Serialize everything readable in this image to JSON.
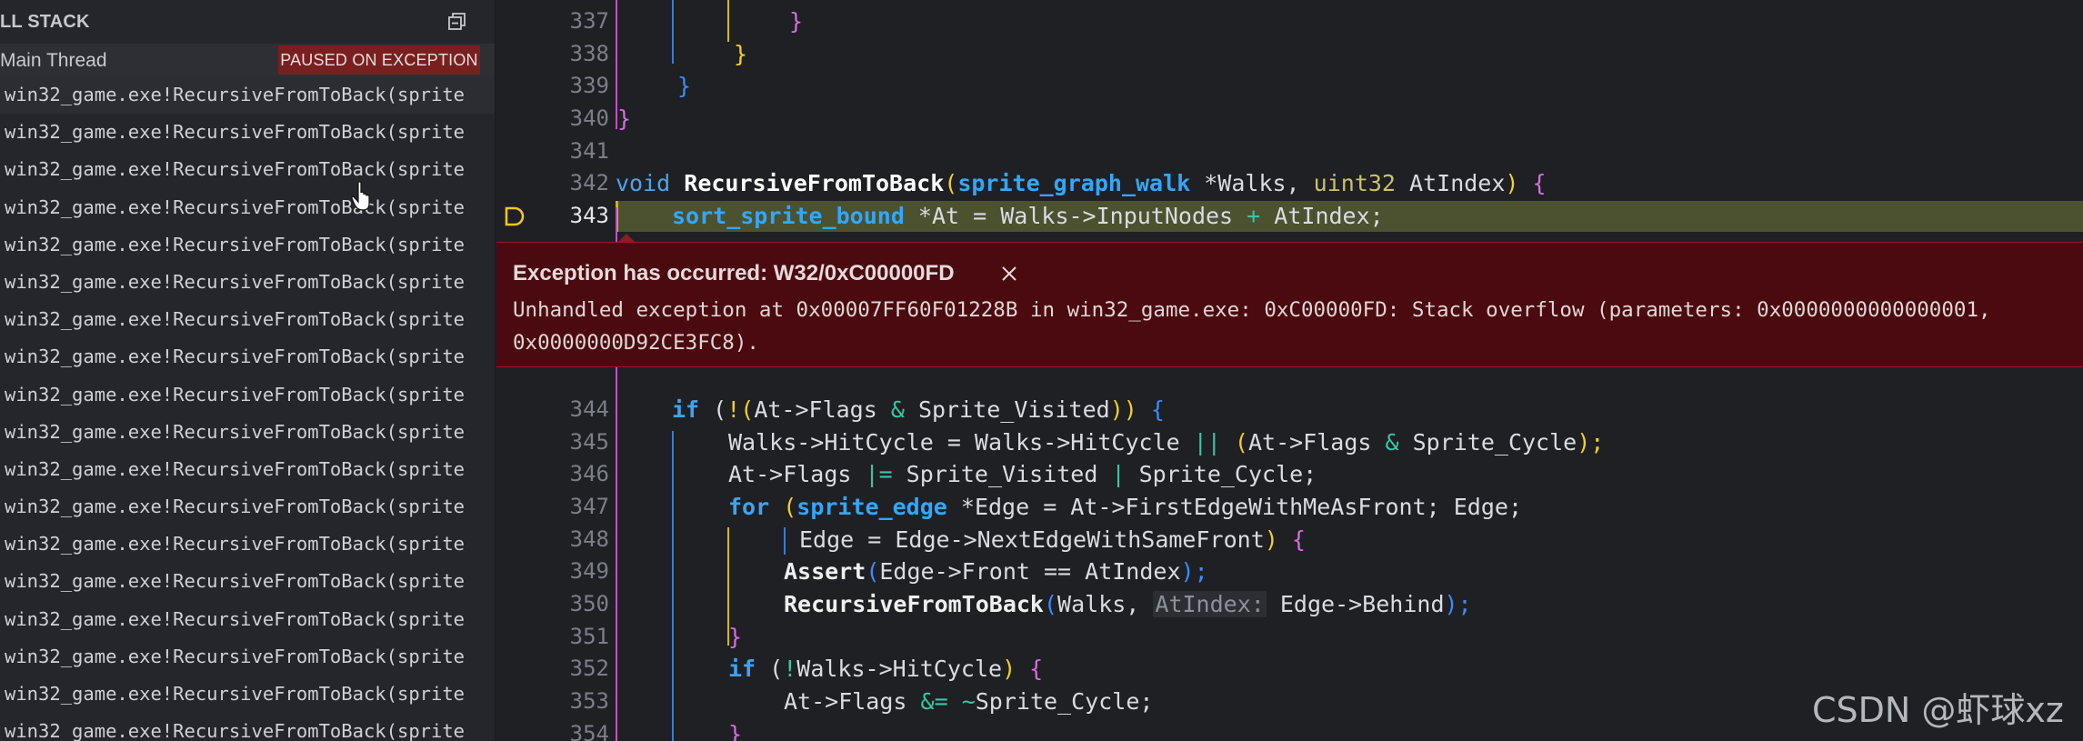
{
  "call_stack": {
    "title": "LL STACK",
    "thread": "Main Thread",
    "badge": "PAUSED ON EXCEPTION",
    "frames": [
      "win32_game.exe!RecursiveFromToBack(sprite",
      "win32_game.exe!RecursiveFromToBack(sprite",
      "win32_game.exe!RecursiveFromToBack(sprite",
      "win32_game.exe!RecursiveFromToBack(sprite",
      "win32_game.exe!RecursiveFromToBack(sprite",
      "win32_game.exe!RecursiveFromToBack(sprite",
      "win32_game.exe!RecursiveFromToBack(sprite",
      "win32_game.exe!RecursiveFromToBack(sprite",
      "win32_game.exe!RecursiveFromToBack(sprite",
      "win32_game.exe!RecursiveFromToBack(sprite",
      "win32_game.exe!RecursiveFromToBack(sprite",
      "win32_game.exe!RecursiveFromToBack(sprite",
      "win32_game.exe!RecursiveFromToBack(sprite",
      "win32_game.exe!RecursiveFromToBack(sprite",
      "win32_game.exe!RecursiveFromToBack(sprite",
      "win32_game.exe!RecursiveFromToBack(sprite",
      "win32_game.exe!RecursiveFromToBack(sprite",
      "win32_game.exe!RecursiveFromToBack(sprite"
    ]
  },
  "editor": {
    "line_numbers": [
      "337",
      "338",
      "339",
      "340",
      "341",
      "342",
      "343",
      "344",
      "345",
      "346",
      "347",
      "348",
      "349",
      "350",
      "351",
      "352",
      "353",
      "354"
    ],
    "current_line": "343",
    "code": {
      "l337": "}",
      "l338": "}",
      "l339": "}",
      "l340": "}",
      "l342_kw": "void",
      "l342_fn": "RecursiveFromToBack",
      "l342_open": "(",
      "l342_t1": "sprite_graph_walk",
      "l342_p1": " *Walks, ",
      "l342_t2": "uint32",
      "l342_p2": " AtIndex",
      "l342_close": ")",
      "l342_brace": " {",
      "l343_t": "sort_sprite_bound",
      "l343_rest": " *At = Walks->InputNodes ",
      "l343_plus": "+",
      "l343_end": " AtIndex;",
      "l344_kw": "if",
      "l344_a": " (",
      "l344_b": "!(",
      "l344_c": "At->Flags ",
      "l344_amp": "&",
      "l344_d": " Sprite_Visited",
      "l344_e": "))",
      "l344_f": " {",
      "l345_a": "Walks->HitCycle = Walks->HitCycle ",
      "l345_or": "||",
      "l345_b": " (",
      "l345_c": "At->Flags ",
      "l345_amp": "&",
      "l345_d": " Sprite_Cycle",
      "l345_e": ");",
      "l346_a": "At->Flags ",
      "l346_op": "|=",
      "l346_b": " Sprite_Visited ",
      "l346_bar": "|",
      "l346_c": " Sprite_Cycle;",
      "l347_kw": "for",
      "l347_a": " (",
      "l347_t": "sprite_edge",
      "l347_b": " *Edge = At->FirstEdgeWithMeAsFront; Edge;",
      "l348_a": "Edge = Edge->NextEdgeWithSameFront",
      "l348_b": ")",
      "l348_c": " {",
      "l349_fn": "Assert",
      "l349_a": "(",
      "l349_b": "Edge->Front == AtIndex",
      "l349_c": ");",
      "l350_fn": "RecursiveFromToBack",
      "l350_a": "(",
      "l350_b": "Walks, ",
      "l350_hint": "AtIndex:",
      "l350_c": " Edge->Behind",
      "l350_d": ");",
      "l351": "}",
      "l352_kw": "if",
      "l352_a": " (",
      "l352_b": "!",
      "l352_c": "Walks->HitCycle",
      "l352_d": ")",
      "l352_e": " {",
      "l353_a": "At->Flags ",
      "l353_op": "&=",
      "l353_b": " ",
      "l353_tilde": "~",
      "l353_c": "Sprite_Cycle;",
      "l354": "}"
    },
    "exception": {
      "title": "Exception has occurred: W32/0xC00000FD",
      "message_line1": "Unhandled exception at 0x00007FF60F01228B in win32_game.exe: 0xC00000FD: Stack overflow (parameters: 0x0000000000000001,",
      "message_line2": "0x0000000D92CE3FC8)."
    }
  },
  "watermark": "CSDN @虾球xz",
  "colors": {
    "panel_bg": "#25262b",
    "editor_bg": "#1f2024",
    "exception_bg": "#4a0a0f",
    "badge_bg": "#7a1f1f",
    "current_line_bg": "#4c5130"
  }
}
